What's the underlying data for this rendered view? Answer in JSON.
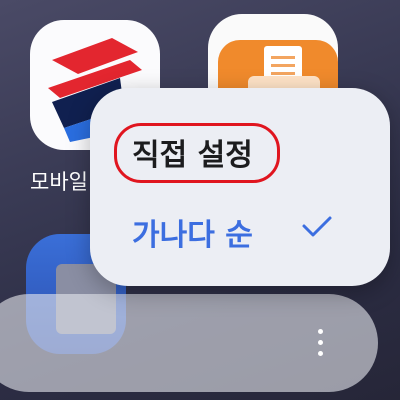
{
  "home": {
    "apps": [
      {
        "label": "모바일"
      }
    ]
  },
  "menu": {
    "items": [
      {
        "label": "직접 설정",
        "selected": false
      },
      {
        "label": "가나다 순",
        "selected": true
      }
    ]
  },
  "colors": {
    "accent": "#3c6ee0",
    "highlight_ring": "#e0151f",
    "menu_bg": "#eceef4"
  },
  "icons": {
    "app_1": "mobile-banking-app-icon",
    "app_2": "printer-app-icon",
    "more": "more-vertical-icon",
    "check": "check-icon"
  }
}
